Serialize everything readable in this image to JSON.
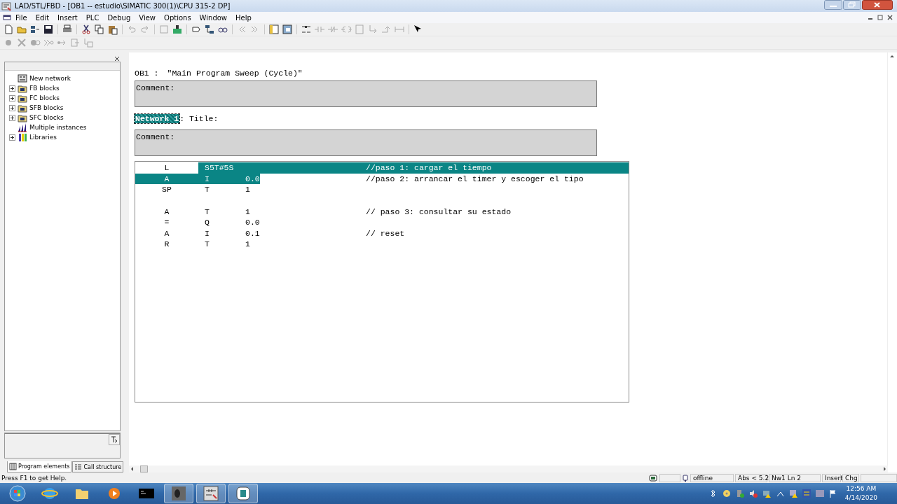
{
  "window": {
    "title": "LAD/STL/FBD  - [OB1 -- estudio\\SIMATIC 300(1)\\CPU 315-2 DP]"
  },
  "menu": [
    "File",
    "Edit",
    "Insert",
    "PLC",
    "Debug",
    "View",
    "Options",
    "Window",
    "Help"
  ],
  "sidebar": {
    "items": [
      {
        "label": "New network",
        "kind": "network",
        "expandable": false
      },
      {
        "label": "FB blocks",
        "kind": "folder",
        "expandable": true
      },
      {
        "label": "FC blocks",
        "kind": "folder",
        "expandable": true
      },
      {
        "label": "SFB blocks",
        "kind": "folder",
        "expandable": true
      },
      {
        "label": "SFC blocks",
        "kind": "folder",
        "expandable": true
      },
      {
        "label": "Multiple instances",
        "kind": "instances",
        "expandable": false
      },
      {
        "label": "Libraries",
        "kind": "library",
        "expandable": true
      }
    ],
    "tabs": [
      {
        "label": "Program elements",
        "selected": true
      },
      {
        "label": "Call structure",
        "selected": false
      }
    ]
  },
  "editor": {
    "block": "OB1 :",
    "block_title": "\"Main Program Sweep (Cycle)\"",
    "block_comment": "Comment:",
    "network": {
      "label": "Network 1",
      "title": ": Title:",
      "comment": "Comment:",
      "selected": true
    },
    "rows": [
      {
        "kind": "code",
        "op": "L",
        "type": "S5T#5S",
        "comment": "//paso 1: cargar el tiempo",
        "selected": true
      },
      {
        "kind": "code",
        "op": "A",
        "type": "I",
        "address": "0.0",
        "comment": "//paso 2: arrancar el timer y escoger el tipo",
        "selected": true
      },
      {
        "kind": "code",
        "op": "SP",
        "type": "T",
        "address": "1",
        "selected": false
      },
      {
        "kind": "blank"
      },
      {
        "kind": "code",
        "op": "A",
        "type": "T",
        "address": "1",
        "comment": "// paso 3: consultar su estado",
        "selected": false
      },
      {
        "kind": "code",
        "op": "=",
        "type": "Q",
        "address": "0.0",
        "selected": false
      },
      {
        "kind": "code",
        "op": "A",
        "type": "I",
        "address": "0.1",
        "comment": "// reset",
        "selected": false
      },
      {
        "kind": "code",
        "op": "R",
        "type": "T",
        "address": "1",
        "selected": false
      }
    ]
  },
  "status_bar": {
    "help": "Press F1 to get Help.",
    "mode": "offline",
    "position": "Abs < 5.2",
    "line": "Nw1 Ln 2",
    "insert": "Insert",
    "change": "Chg"
  },
  "taskbar": {
    "time": "12:56 AM",
    "date": "4/14/2020"
  }
}
